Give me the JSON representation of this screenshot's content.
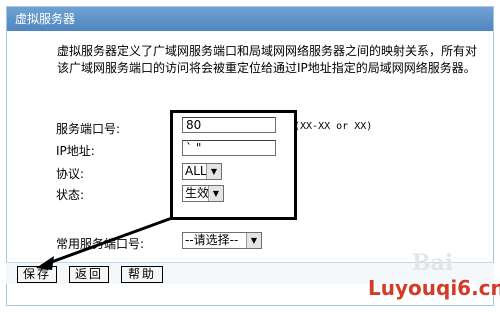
{
  "window": {
    "title": "虚拟服务器"
  },
  "description": "虚拟服务器定义了广域网服务端口和局域网网络服务器之间的映射关系，所有对该广域网服务端口的访问将会被重定位给通过IP地址指定的局域网网络服务器。",
  "form": {
    "service_port": {
      "label": "服务端口号:",
      "value": "80",
      "hint": "(XX-XX or XX)"
    },
    "ip_address": {
      "label": "IP地址:",
      "value": "` \""
    },
    "protocol": {
      "label": "协议:",
      "value": "ALL"
    },
    "status": {
      "label": "状态:",
      "value": "生效"
    },
    "common_port": {
      "label": "常用服务端口号:",
      "value": "--请选择--"
    }
  },
  "buttons": {
    "save": "保存",
    "back": "返回",
    "help": "帮助"
  },
  "watermark": {
    "site": "Luyouqi6.cn",
    "baidu": "Bai"
  },
  "colors": {
    "titlebar": "#5a8fc8",
    "watermark": "#d23b2a"
  }
}
